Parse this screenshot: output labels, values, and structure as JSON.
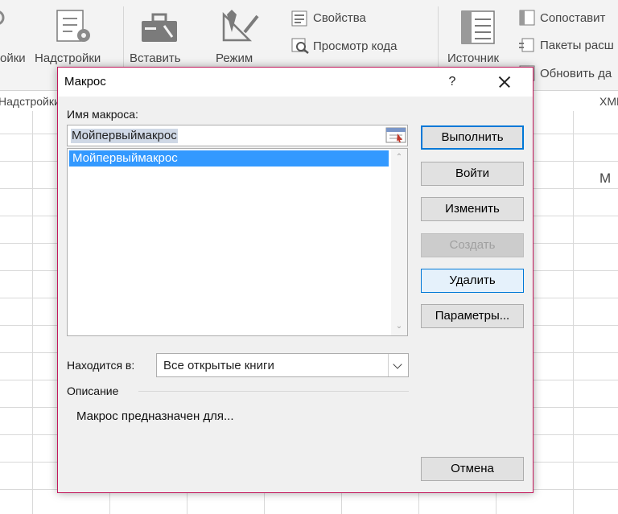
{
  "ribbon": {
    "items": {
      "addins_partial": "ойки",
      "addins": "Надстройки",
      "insert": "Вставить",
      "mode": "Режим",
      "properties": "Свойства",
      "view_code": "Просмотр кода",
      "source": "Источник",
      "map_props": "Сопоставит",
      "expansion_packs": "Пакеты расш",
      "refresh_data": "Обновить да"
    },
    "groups": {
      "addins": "Надстройки",
      "xml": "XML"
    }
  },
  "sheet": {
    "column_header": "M"
  },
  "dialog": {
    "title": "Макрос",
    "help": "?",
    "macro_name_label": "Имя макроса:",
    "macro_name_value": "Мойпервыймакрос",
    "macros": [
      "Мойпервыймакрос"
    ],
    "buttons": {
      "run": "Выполнить",
      "step_into": "Войти",
      "edit": "Изменить",
      "create": "Создать",
      "delete": "Удалить",
      "options": "Параметры...",
      "cancel": "Отмена"
    },
    "location_label": "Находится в:",
    "location_value": "Все открытые книги",
    "description_label": "Описание",
    "description_text": "Макрос предназначен для..."
  }
}
